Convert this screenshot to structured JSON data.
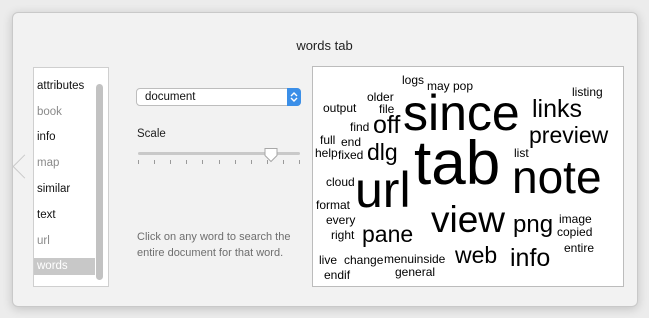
{
  "title": "words tab",
  "sidebar": {
    "items": [
      {
        "label": "attributes",
        "style": "normal"
      },
      {
        "label": "book",
        "style": "dim"
      },
      {
        "label": "info",
        "style": "normal"
      },
      {
        "label": "map",
        "style": "dim"
      },
      {
        "label": "similar",
        "style": "normal"
      },
      {
        "label": "text",
        "style": "normal"
      },
      {
        "label": "url",
        "style": "dim"
      },
      {
        "label": "words",
        "style": "selected"
      }
    ]
  },
  "scope_select": {
    "value": "document",
    "accent": "#3b8fe8"
  },
  "scale": {
    "label": "Scale",
    "value_fraction": 0.82,
    "tick_count": 11
  },
  "help_text": "Click on any word to search the entire document for that word.",
  "cloud": {
    "words": [
      "logs",
      "may",
      "pop",
      "older",
      "file",
      "output",
      "since",
      "links",
      "listing",
      "find",
      "off",
      "end",
      "preview",
      "full",
      "help",
      "fixed",
      "dlg",
      "tab",
      "list",
      "note",
      "cloud",
      "url",
      "format",
      "view",
      "png",
      "image",
      "every",
      "copied",
      "right",
      "pane",
      "entire",
      "web",
      "info",
      "live",
      "change",
      "menu",
      "inside",
      "endif",
      "general"
    ]
  }
}
